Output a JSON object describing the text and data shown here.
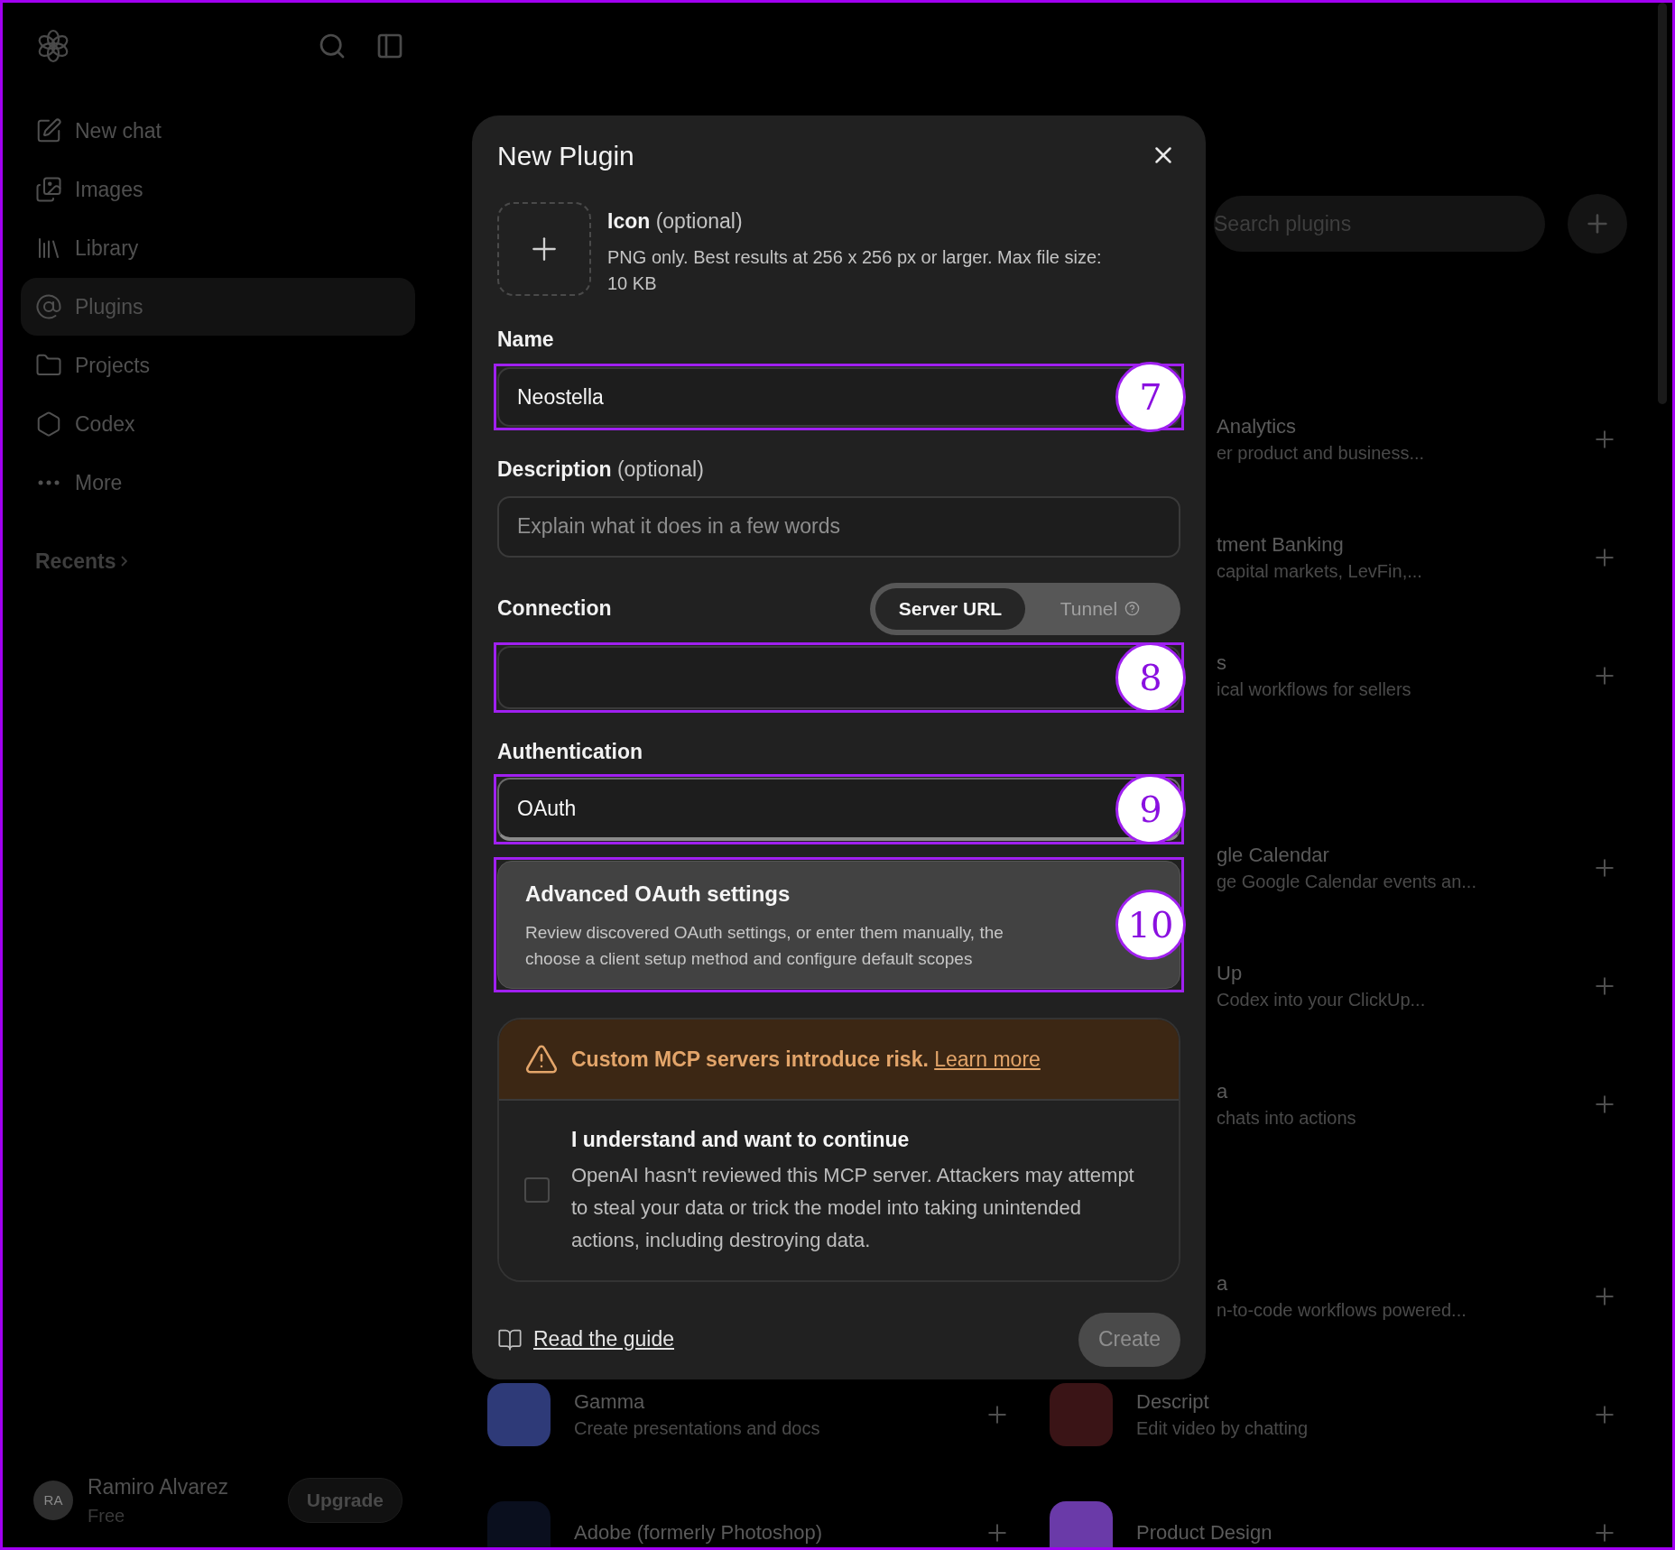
{
  "sidebar": {
    "nav": [
      {
        "label": "New chat",
        "selected": false
      },
      {
        "label": "Images",
        "selected": false
      },
      {
        "label": "Library",
        "selected": false
      },
      {
        "label": "Plugins",
        "selected": true
      },
      {
        "label": "Projects",
        "selected": false
      },
      {
        "label": "Codex",
        "selected": false
      },
      {
        "label": "More",
        "selected": false
      }
    ],
    "recents": "Recents",
    "user": {
      "initials": "RA",
      "name": "Ramiro Alvarez",
      "plan": "Free"
    },
    "upgrade": "Upgrade"
  },
  "main": {
    "search": {
      "placeholder": "Search plugins"
    },
    "sections": [
      {
        "rows": [
          {
            "right": {
              "title": "Analytics",
              "description": "er product and business..."
            }
          },
          {
            "right": {
              "title": "tment Banking",
              "description": "capital markets, LevFin,..."
            }
          },
          {
            "right": {
              "title": "s",
              "description": "ical workflows for sellers"
            }
          }
        ]
      },
      {
        "rows": [
          {
            "right": {
              "title": "gle Calendar",
              "description": "ge Google Calendar events an..."
            }
          },
          {
            "right": {
              "title": "Up",
              "description": "Codex into your ClickUp..."
            }
          },
          {
            "right": {
              "title": "a",
              "description": "chats into actions"
            }
          }
        ]
      },
      {
        "rows": [
          {
            "right": {
              "title": "a",
              "description": "n-to-code workflows powered..."
            }
          },
          {
            "left": {
              "title": "Gamma",
              "description": "Create presentations and docs",
              "color": "#2e3a78"
            },
            "right": {
              "title": "Descript",
              "description": "Edit video by chatting",
              "color": "#3a1416"
            }
          },
          {
            "left": {
              "title": "Adobe (formerly Photoshop)",
              "color": "#0a0f1e"
            },
            "right": {
              "title": "Product Design",
              "color": "#6a3aa8"
            }
          }
        ]
      }
    ]
  },
  "dialog": {
    "title": "New Plugin",
    "icon_upload": {
      "label": "Icon",
      "optional": "(optional)",
      "hint": "PNG only. Best results at 256 x 256 px or larger. Max file size: 10 KB"
    },
    "name": {
      "label": "Name",
      "value": "Neostella",
      "callout": "7"
    },
    "description": {
      "label": "Description",
      "optional": "(optional)",
      "placeholder": "Explain what it does in a few words"
    },
    "connection": {
      "label": "Connection",
      "options": [
        {
          "label": "Server URL",
          "selected": true,
          "help": false
        },
        {
          "label": "Tunnel",
          "selected": false,
          "help": true
        }
      ],
      "callout": "8"
    },
    "authentication": {
      "label": "Authentication",
      "value": "OAuth",
      "callout": "9"
    },
    "advanced": {
      "title": "Advanced OAuth settings",
      "description_lines": [
        "Review discovered OAuth settings, or enter them manually, the",
        "choose a client setup method and configure default scopes"
      ],
      "callout": "10"
    },
    "warning": {
      "text": "Custom MCP servers introduce risk.",
      "link": "Learn more",
      "confirm_title": "I understand and want to continue",
      "confirm_body": "OpenAI hasn't reviewed this MCP server. Attackers may attempt to steal your data or trick the model into taking unintended actions, including destroying data.",
      "checked": false
    },
    "guide_link": "Read the guide",
    "create": {
      "label": "Create",
      "disabled": true
    }
  }
}
